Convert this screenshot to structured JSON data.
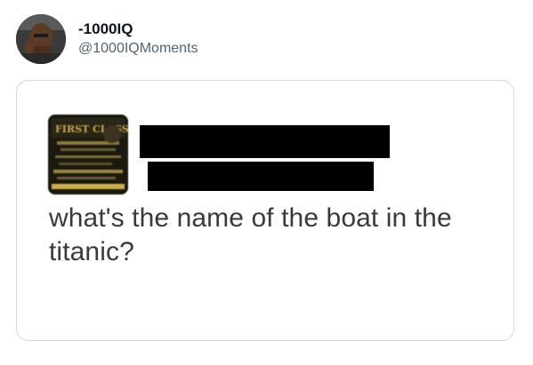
{
  "tweet": {
    "display_name": "-1000IQ",
    "handle": "@1000IQMoments"
  },
  "embedded_post": {
    "text": "what's the name of the boat in the titanic?",
    "thumbnail": {
      "icon": "first-class-flyer-image",
      "logo_text": "FIRST CLASS"
    }
  }
}
